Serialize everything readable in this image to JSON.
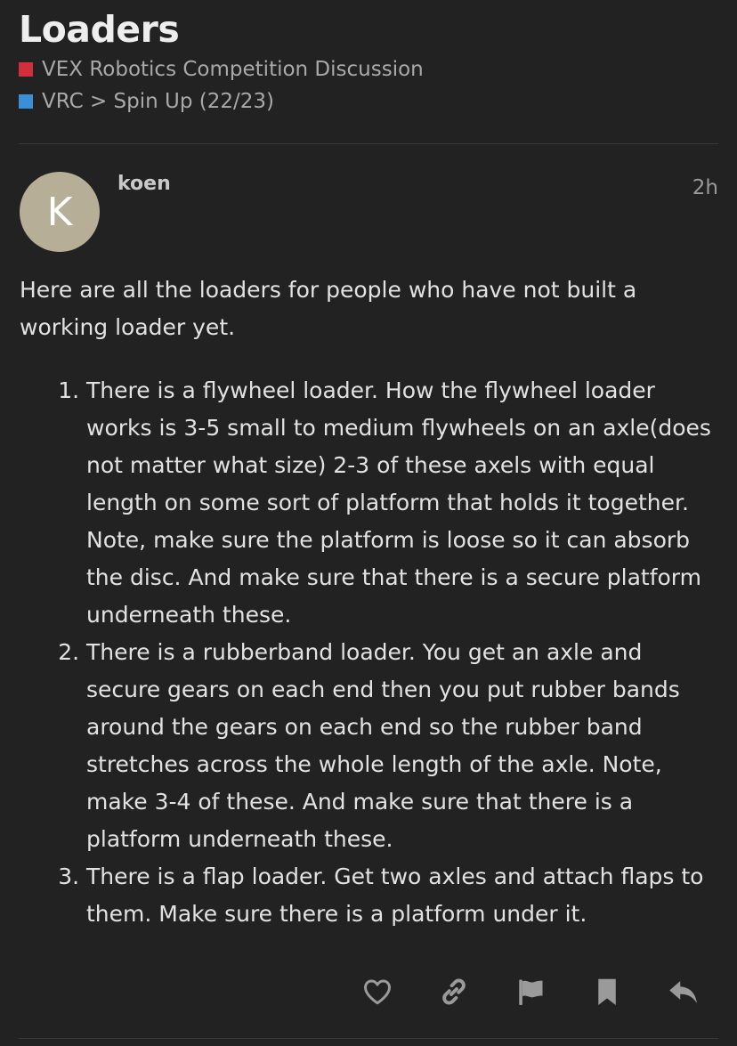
{
  "topic": {
    "title": "Loaders",
    "categories": [
      {
        "label": "VEX Robotics Competition Discussion",
        "color": "#d32f3a"
      },
      {
        "label": "VRC > Spin Up (22/23)",
        "color": "#3b8fd6"
      }
    ]
  },
  "post": {
    "avatar_letter": "K",
    "avatar_color": "#b7ae97",
    "username": "koen",
    "time": "2h",
    "intro": "Here are all the loaders for people who have not built a working loader yet.",
    "items": [
      "There is a flywheel loader. How the flywheel loader works is 3-5 small to medium flywheels on an axle(does not matter what size) 2-3 of these axels with equal length on some sort of platform that holds it together. Note, make sure the platform is loose so it can absorb the disc. And make sure that there is a secure platform underneath these.",
      "There is a rubberband loader. You get an axle and secure gears on each end then you put rubber bands around the gears on each end so the rubber band stretches across the whole length of the axle. Note, make 3-4 of these. And make sure that there is a platform underneath these.",
      "There is a flap loader. Get two axles and attach flaps to them. Make sure there is a platform under it."
    ]
  },
  "actions": [
    {
      "name": "like-icon"
    },
    {
      "name": "link-icon"
    },
    {
      "name": "flag-icon"
    },
    {
      "name": "bookmark-icon"
    },
    {
      "name": "reply-icon"
    }
  ]
}
